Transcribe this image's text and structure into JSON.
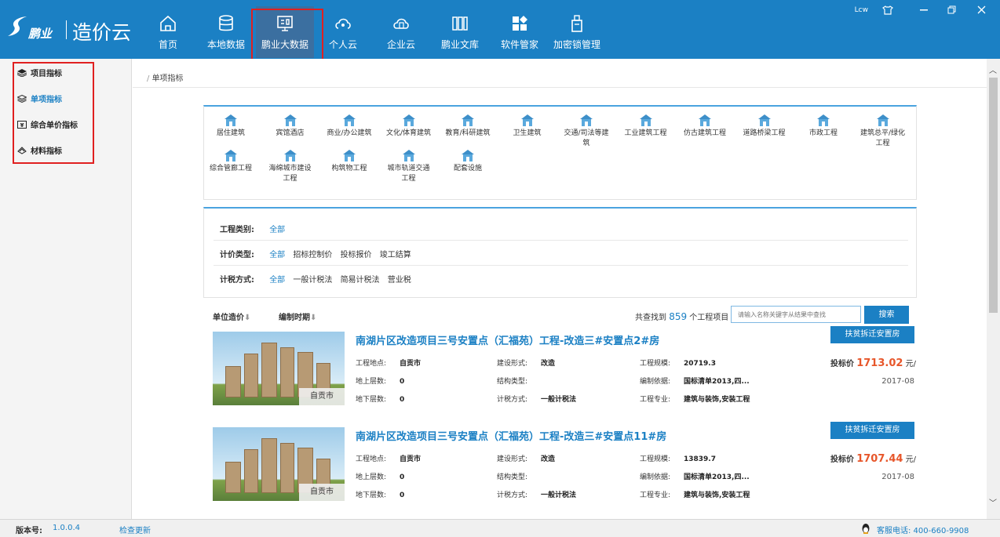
{
  "topbar": {
    "brand": "鹏业",
    "product": "造价云",
    "nav": [
      {
        "label": "首页",
        "icon": "home-icon"
      },
      {
        "label": "本地数据",
        "icon": "database-icon"
      },
      {
        "label": "鹏业大数据",
        "icon": "monitor-icon",
        "active": true
      },
      {
        "label": "个人云",
        "icon": "personal-cloud-icon"
      },
      {
        "label": "企业云",
        "icon": "enterprise-cloud-icon"
      },
      {
        "label": "鹏业文库",
        "icon": "library-icon"
      },
      {
        "label": "软件管家",
        "icon": "apps-icon"
      },
      {
        "label": "加密锁管理",
        "icon": "usb-key-icon"
      }
    ],
    "user": "Lcw"
  },
  "sidebar": {
    "items": [
      {
        "label": "项目指标",
        "icon": "layers-icon"
      },
      {
        "label": "单项指标",
        "icon": "layers-outline-icon",
        "active": true
      },
      {
        "label": "综合单价指标",
        "icon": "price-tag-icon"
      },
      {
        "label": "材料指标",
        "icon": "material-icon"
      }
    ]
  },
  "breadcrumb": "单项指标",
  "categories": [
    "居住建筑",
    "宾馆酒店",
    "商业/办公建筑",
    "文化/体育建筑",
    "教育/科研建筑",
    "卫生建筑",
    "交通/司法等建筑",
    "工业建筑工程",
    "仿古建筑工程",
    "道路桥梁工程",
    "市政工程",
    "建筑总平/绿化工程",
    "综合管廊工程",
    "海绵城市建设工程",
    "构筑物工程",
    "城市轨道交通工程",
    "配套设施"
  ],
  "filters": {
    "project_type": {
      "label": "工程类别:",
      "options": [
        "全部"
      ]
    },
    "pricing_type": {
      "label": "计价类型:",
      "options": [
        "全部",
        "招标控制价",
        "投标报价",
        "竣工结算"
      ]
    },
    "tax_method": {
      "label": "计税方式:",
      "options": [
        "全部",
        "一般计税法",
        "简易计税法",
        "营业税"
      ]
    }
  },
  "sort": {
    "unit_cost": "单位造价",
    "compile_time": "编制时期",
    "found_prefix": "共查找到",
    "found_count": "859",
    "found_suffix": "个工程项目",
    "search_placeholder": "请输入名称关键字从结果中查找",
    "search_button": "搜索"
  },
  "results": [
    {
      "title": "南湖片区改造项目三号安置点（汇福苑）工程-改造三#安置点2#房",
      "location_tag": "自贡市",
      "tag": "扶贫拆迁安置房",
      "fields": {
        "location_label": "工程地点:",
        "location": "自贡市",
        "build_form_label": "建设形式:",
        "build_form": "改造",
        "scale_label": "工程规模:",
        "scale": "20719.3",
        "floors_up_label": "地上层数:",
        "floors_up": "0",
        "structure_label": "结构类型:",
        "structure": "",
        "basis_label": "编制依据:",
        "basis": "国标清单2013,四...",
        "floors_down_label": "地下层数:",
        "floors_down": "0",
        "tax_label": "计税方式:",
        "tax": "一般计税法",
        "major_label": "工程专业:",
        "major": "建筑与装饰,安装工程"
      },
      "price_label": "投标价",
      "price": "1713.02",
      "price_unit": "元/",
      "date": "2017-08"
    },
    {
      "title": "南湖片区改造项目三号安置点（汇福苑）工程-改造三#安置点11#房",
      "location_tag": "自贡市",
      "tag": "扶贫拆迁安置房",
      "fields": {
        "location_label": "工程地点:",
        "location": "自贡市",
        "build_form_label": "建设形式:",
        "build_form": "改造",
        "scale_label": "工程规模:",
        "scale": "13839.7",
        "floors_up_label": "地上层数:",
        "floors_up": "0",
        "structure_label": "结构类型:",
        "structure": "",
        "basis_label": "编制依据:",
        "basis": "国标清单2013,四...",
        "floors_down_label": "地下层数:",
        "floors_down": "0",
        "tax_label": "计税方式:",
        "tax": "一般计税法",
        "major_label": "工程专业:",
        "major": "建筑与装饰,安装工程"
      },
      "price_label": "投标价",
      "price": "1707.44",
      "price_unit": "元/",
      "date": "2017-08"
    }
  ],
  "status": {
    "version_label": "版本号:",
    "version": "1.0.0.4",
    "check_update": "检查更新",
    "service": "客服电话: 400-660-9908"
  },
  "colors": {
    "primary": "#1b80c4",
    "price": "#e7562a",
    "highlight": "#e02020"
  }
}
